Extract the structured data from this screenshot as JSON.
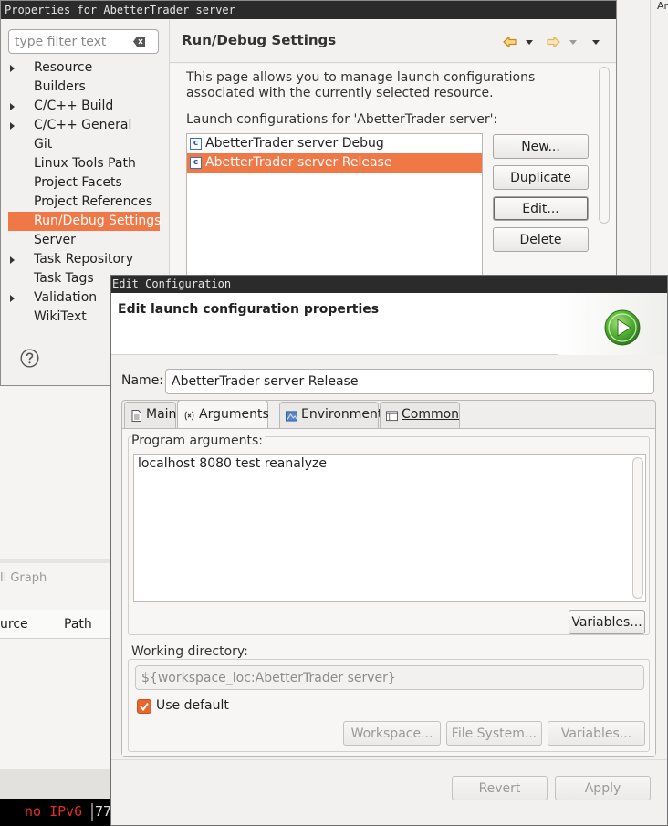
{
  "background": {
    "right_text": "Ar",
    "call_graph_tab": "ll Graph",
    "col_source": "urce",
    "col_path": "Path",
    "terminal_status": "no IPv6",
    "terminal_number": "77"
  },
  "properties_window": {
    "title": "Properties for AbetterTrader server",
    "filter": {
      "placeholder": "type filter text",
      "value": ""
    },
    "tree": [
      {
        "label": "Resource",
        "expandable": true,
        "selected": false
      },
      {
        "label": "Builders",
        "expandable": false,
        "selected": false
      },
      {
        "label": "C/C++ Build",
        "expandable": true,
        "selected": false
      },
      {
        "label": "C/C++ General",
        "expandable": true,
        "selected": false
      },
      {
        "label": "Git",
        "expandable": false,
        "selected": false
      },
      {
        "label": "Linux Tools Path",
        "expandable": false,
        "selected": false
      },
      {
        "label": "Project Facets",
        "expandable": false,
        "selected": false
      },
      {
        "label": "Project References",
        "expandable": false,
        "selected": false
      },
      {
        "label": "Run/Debug Settings",
        "expandable": false,
        "selected": true
      },
      {
        "label": "Server",
        "expandable": false,
        "selected": false
      },
      {
        "label": "Task Repository",
        "expandable": true,
        "selected": false
      },
      {
        "label": "Task Tags",
        "expandable": false,
        "selected": false
      },
      {
        "label": "Validation",
        "expandable": true,
        "selected": false
      },
      {
        "label": "WikiText",
        "expandable": false,
        "selected": false
      }
    ],
    "page_heading": "Run/Debug Settings",
    "description": "This page allows you to manage launch configurations associated with the currently selected resource.",
    "launch_label": "Launch configurations for 'AbetterTrader server':",
    "configs": [
      {
        "label": "AbetterTrader server Debug",
        "selected": false
      },
      {
        "label": "AbetterTrader server Release",
        "selected": true
      }
    ],
    "buttons": {
      "new": "New...",
      "duplicate": "Duplicate",
      "edit": "Edit...",
      "delete": "Delete"
    }
  },
  "edit_dialog": {
    "title": "Edit Configuration",
    "heading": "Edit launch configuration properties",
    "name_label": "Name:",
    "name_value": "AbetterTrader server Release",
    "tabs": [
      {
        "label": "Main",
        "active": false
      },
      {
        "label": "Arguments",
        "active": true
      },
      {
        "label": "Environment",
        "active": false
      },
      {
        "label": "Common",
        "active": false
      }
    ],
    "program_args_label": "Program arguments:",
    "program_args_value": "localhost 8080 test reanalyze",
    "variables_button": "Variables...",
    "working_dir_label": "Working directory:",
    "working_dir_value": "${workspace_loc:AbetterTrader server}",
    "use_default_label": "Use default",
    "use_default_checked": true,
    "wd_buttons": {
      "workspace": "Workspace...",
      "file_system": "File System...",
      "variables": "Variables..."
    },
    "footer_buttons": {
      "revert": "Revert",
      "apply": "Apply"
    }
  },
  "colors": {
    "selection": "#f07746",
    "title_bar": "#2b2b2b",
    "run_icon": "#4caf2f"
  }
}
